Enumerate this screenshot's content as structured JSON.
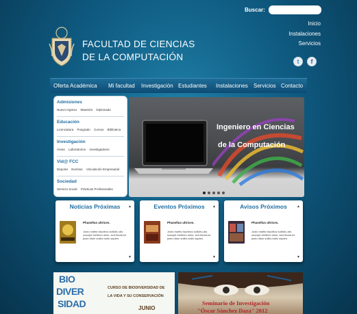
{
  "search": {
    "label": "Buscar:",
    "placeholder": ""
  },
  "top_links": [
    "Inicio",
    "Instalaciones",
    "Servicios"
  ],
  "brand": {
    "line1": "FACULTAD DE CIENCIAS",
    "line2": "DE LA COMPUTACIÓN"
  },
  "social": {
    "twitter": "t",
    "facebook": "f"
  },
  "nav": [
    "Oferta Académica",
    "Mi facultad",
    "Investigación",
    "Estudiantes",
    "Instalaciones",
    "Servicios",
    "Contacto"
  ],
  "sidebar": [
    {
      "heading": "Admisiones",
      "links": [
        "Nuevo Ingreso",
        "Maestría",
        "Diplomado"
      ]
    },
    {
      "heading": "Educación",
      "links": [
        "Licenciatura",
        "Posgrado",
        "Cursos",
        "Biblioteca"
      ]
    },
    {
      "heading": "Investigación",
      "links": [
        "Áreas",
        "Laboratorios",
        "Investigadores"
      ]
    },
    {
      "heading": "Vid@ FCC",
      "links": [
        "Deporte",
        "Eventos",
        "Vinculación Empresarial"
      ]
    },
    {
      "heading": "Sociedad",
      "links": [
        "Servicio Social",
        "Prácticas Profesionales"
      ]
    }
  ],
  "slider": {
    "line1": "Ingeniero en Ciencias",
    "line2": "de la Computación",
    "slides": 5,
    "active": 1
  },
  "cards": [
    {
      "title": "Noticias Próximas",
      "heading": "Phasellus ultrices.",
      "text": "Justo mattis faucibus sollicitu-din, suscipit eleifend dolor, sed tincidunt justo diam sollici-tudin sapien."
    },
    {
      "title": "Eventos Próximos",
      "heading": "Phasellus ultrices.",
      "text": "Justo mattis faucibus sollicitu-din, suscipit eleifend dolor, sed tincidunt justo diam sollici-tudin sapien."
    },
    {
      "title": "Avisos Próximos",
      "heading": "Phasellus ultrices.",
      "text": "Justo mattis faucibus sollicitu-din, suscipit eleifend dolor, sed tincidunt justo diam sollici-tudin sapien."
    }
  ],
  "banners": {
    "bio_words": [
      "BIO",
      "DIVER",
      "SIDAD"
    ],
    "bio_line1": "CURSO DE BIODIVERSIDAD DE",
    "bio_line2": "LA VIDA Y SU CONSERVACIÓN",
    "bio_month": "JUNIO",
    "sem_line1": "Seminario de Investigación",
    "sem_line2": "\"Óscar Sánchez Daza\" 2012"
  },
  "colors": {
    "accent": "#1f6da0",
    "background": "#0f5b82"
  }
}
